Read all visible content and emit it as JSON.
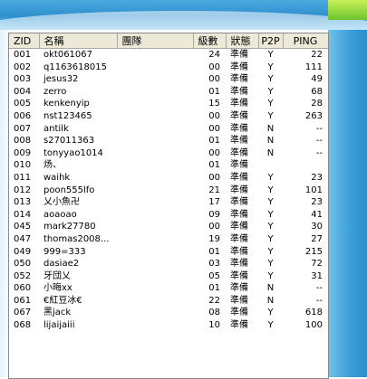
{
  "columns": [
    "ZID",
    "名稱",
    "團隊",
    "級數",
    "狀態",
    "P2P",
    "PING"
  ],
  "rows": [
    {
      "zid": "001",
      "name": "okt061067",
      "team": "",
      "level": "24",
      "status": "準備",
      "p2p": "Y",
      "ping": "22"
    },
    {
      "zid": "002",
      "name": "q1163618015",
      "team": "",
      "level": "00",
      "status": "準備",
      "p2p": "Y",
      "ping": "111"
    },
    {
      "zid": "003",
      "name": "jesus32",
      "team": "",
      "level": "00",
      "status": "準備",
      "p2p": "Y",
      "ping": "49"
    },
    {
      "zid": "004",
      "name": "zerro",
      "team": "",
      "level": "01",
      "status": "準備",
      "p2p": "Y",
      "ping": "68"
    },
    {
      "zid": "005",
      "name": "kenkenyip",
      "team": "",
      "level": "15",
      "status": "準備",
      "p2p": "Y",
      "ping": "28"
    },
    {
      "zid": "006",
      "name": "nst123465",
      "team": "",
      "level": "00",
      "status": "準備",
      "p2p": "Y",
      "ping": "263"
    },
    {
      "zid": "007",
      "name": "antilk",
      "team": "",
      "level": "00",
      "status": "準備",
      "p2p": "N",
      "ping": "--"
    },
    {
      "zid": "008",
      "name": "s27011363",
      "team": "",
      "level": "01",
      "status": "準備",
      "p2p": "N",
      "ping": "--"
    },
    {
      "zid": "009",
      "name": "tonyyao1014",
      "team": "",
      "level": "00",
      "status": "準備",
      "p2p": "N",
      "ping": "--"
    },
    {
      "zid": "010",
      "name": "炀、",
      "team": "",
      "level": "01",
      "status": "準備",
      "p2p": "",
      "ping": ""
    },
    {
      "zid": "011",
      "name": "waihk",
      "team": "",
      "level": "00",
      "status": "準備",
      "p2p": "Y",
      "ping": "23"
    },
    {
      "zid": "012",
      "name": "poon555lfo",
      "team": "",
      "level": "21",
      "status": "準備",
      "p2p": "Y",
      "ping": "101"
    },
    {
      "zid": "013",
      "name": "乂小魚卍",
      "team": "",
      "level": "17",
      "status": "準備",
      "p2p": "Y",
      "ping": "23"
    },
    {
      "zid": "014",
      "name": "aoaoao",
      "team": "",
      "level": "09",
      "status": "準備",
      "p2p": "Y",
      "ping": "41"
    },
    {
      "zid": "045",
      "name": "mark27780",
      "team": "",
      "level": "00",
      "status": "準備",
      "p2p": "Y",
      "ping": "30"
    },
    {
      "zid": "047",
      "name": "thomas2008...",
      "team": "",
      "level": "19",
      "status": "準備",
      "p2p": "Y",
      "ping": "27"
    },
    {
      "zid": "049",
      "name": "999=333",
      "team": "",
      "level": "01",
      "status": "準備",
      "p2p": "Y",
      "ping": "215"
    },
    {
      "zid": "050",
      "name": "dasiae2",
      "team": "",
      "level": "03",
      "status": "準備",
      "p2p": "Y",
      "ping": "72"
    },
    {
      "zid": "052",
      "name": "牙団乂",
      "team": "",
      "level": "05",
      "status": "準備",
      "p2p": "Y",
      "ping": "31"
    },
    {
      "zid": "060",
      "name": "小晦xx",
      "team": "",
      "level": "01",
      "status": "準備",
      "p2p": "N",
      "ping": "--"
    },
    {
      "zid": "061",
      "name": "€紅豆冰€",
      "team": "",
      "level": "22",
      "status": "準備",
      "p2p": "N",
      "ping": "--"
    },
    {
      "zid": "067",
      "name": "黑jack",
      "team": "",
      "level": "08",
      "status": "準備",
      "p2p": "Y",
      "ping": "618"
    },
    {
      "zid": "068",
      "name": "lijaijaiii",
      "team": "",
      "level": "10",
      "status": "準備",
      "p2p": "Y",
      "ping": "100"
    }
  ],
  "colors": {
    "header_bg": "#ece9d8",
    "banner": "#2f8fce",
    "accent": "#6cc52c"
  }
}
